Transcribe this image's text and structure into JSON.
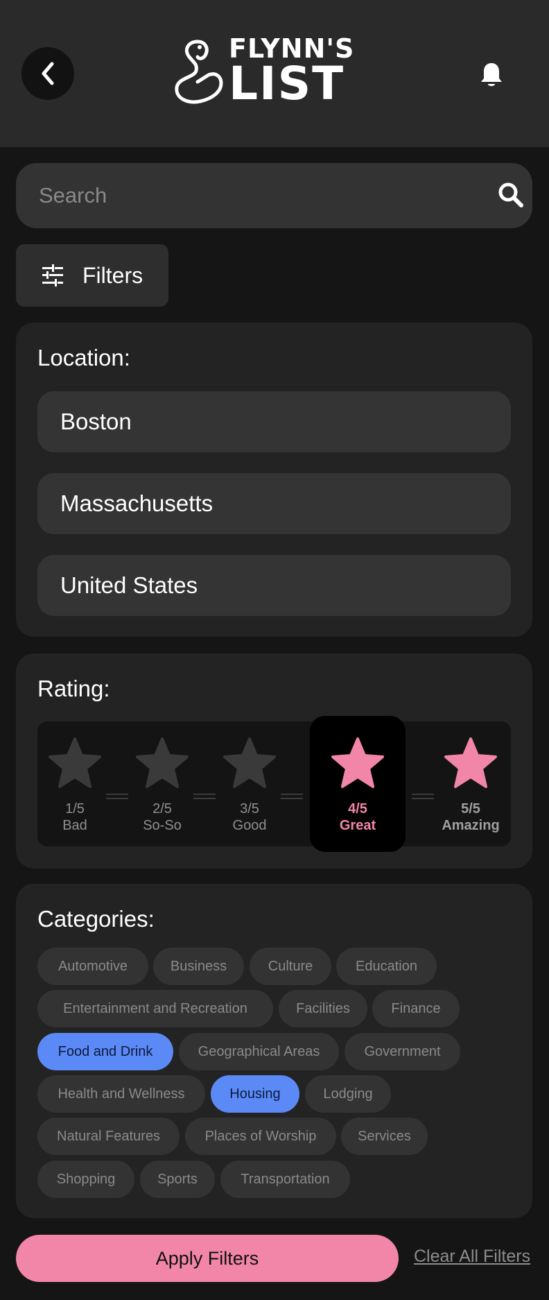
{
  "header": {
    "logo_top": "FLYNN'S",
    "logo_bottom": "LIST"
  },
  "search": {
    "placeholder": "Search"
  },
  "filters": {
    "label": "Filters"
  },
  "location": {
    "title": "Location:",
    "values": [
      "Boston",
      "Massachusetts",
      "United States"
    ]
  },
  "rating": {
    "title": "Rating:",
    "selected": "4/5",
    "options": [
      {
        "num": "1/5",
        "word": "Bad"
      },
      {
        "num": "2/5",
        "word": "So-So"
      },
      {
        "num": "3/5",
        "word": "Good"
      },
      {
        "num": "4/5",
        "word": "Great"
      },
      {
        "num": "5/5",
        "word": "Amazing"
      }
    ]
  },
  "categories": {
    "title": "Categories:",
    "items": [
      {
        "label": "Automotive",
        "selected": false
      },
      {
        "label": "Business",
        "selected": false
      },
      {
        "label": "Culture",
        "selected": false
      },
      {
        "label": "Education",
        "selected": false
      },
      {
        "label": "Entertainment and Recreation",
        "selected": false
      },
      {
        "label": "Facilities",
        "selected": false
      },
      {
        "label": "Finance",
        "selected": false
      },
      {
        "label": "Food and Drink",
        "selected": true
      },
      {
        "label": "Geographical Areas",
        "selected": false
      },
      {
        "label": "Government",
        "selected": false
      },
      {
        "label": "Health and Wellness",
        "selected": false
      },
      {
        "label": "Housing",
        "selected": true
      },
      {
        "label": "Lodging",
        "selected": false
      },
      {
        "label": "Natural Features",
        "selected": false
      },
      {
        "label": "Places of Worship",
        "selected": false
      },
      {
        "label": "Services",
        "selected": false
      },
      {
        "label": "Shopping",
        "selected": false
      },
      {
        "label": "Sports",
        "selected": false
      },
      {
        "label": "Transportation",
        "selected": false
      }
    ]
  },
  "actions": {
    "apply_label": "Apply Filters",
    "clear_label": "Clear All Filters"
  },
  "colors": {
    "accent_pink": "#f286a8",
    "chip_selected": "#5b8af7"
  },
  "icons": {
    "back": "chevron-left-icon",
    "bell": "bell-icon",
    "search": "search-icon",
    "filters": "sliders-icon",
    "logo": "swan-logo"
  }
}
